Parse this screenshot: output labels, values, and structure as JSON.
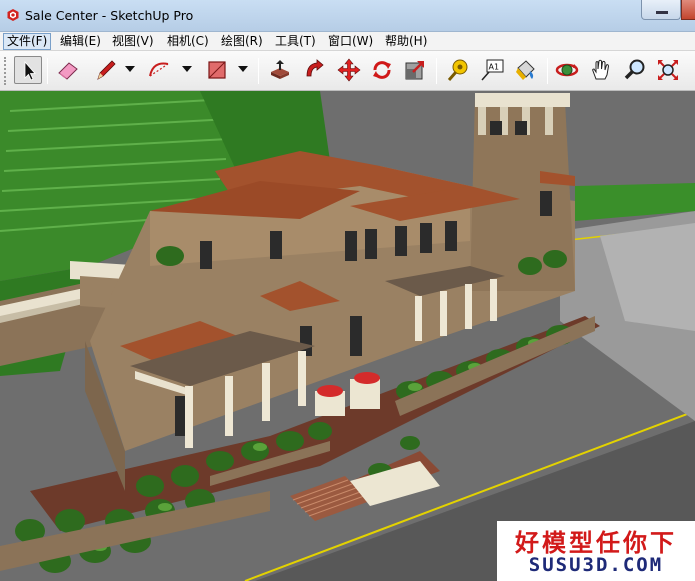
{
  "window": {
    "title": "Sale Center - SketchUp Pro",
    "icon": "sketchup-logo-icon"
  },
  "menu": {
    "items": [
      {
        "label": "文件(F)"
      },
      {
        "label": "编辑(E)"
      },
      {
        "label": "视图(V)"
      },
      {
        "label": "相机(C)"
      },
      {
        "label": "绘图(R)"
      },
      {
        "label": "工具(T)"
      },
      {
        "label": "窗口(W)"
      },
      {
        "label": "帮助(H)"
      }
    ]
  },
  "toolbar": {
    "tools": [
      {
        "name": "select-arrow-icon"
      },
      {
        "name": "eraser-icon"
      },
      {
        "name": "pencil-line-icon"
      },
      {
        "name": "arc-icon"
      },
      {
        "name": "rectangle-icon"
      },
      {
        "name": "push-pull-icon"
      },
      {
        "name": "follow-me-icon"
      },
      {
        "name": "move-icon"
      },
      {
        "name": "rotate-icon"
      },
      {
        "name": "scale-icon"
      },
      {
        "name": "tape-measure-icon"
      },
      {
        "name": "text-label-icon"
      },
      {
        "name": "paint-bucket-icon"
      },
      {
        "name": "orbit-icon"
      },
      {
        "name": "pan-hand-icon"
      },
      {
        "name": "zoom-icon"
      },
      {
        "name": "zoom-extents-icon"
      }
    ],
    "text_tool_label": "A1"
  },
  "viewport": {
    "subject": "3d-villa-model"
  },
  "watermark": {
    "line1": "好模型任你下",
    "line2": "SUSU3D.COM"
  },
  "colors": {
    "titlebar": "#c4d9ef",
    "menubar": "#f3f3f3",
    "roof": "#a3522d",
    "stone": "#9a8163",
    "grass": "#3b8a2a",
    "road": "#5c5c5c",
    "watermark_red": "#d21a1a",
    "watermark_blue": "#1e2a78"
  }
}
